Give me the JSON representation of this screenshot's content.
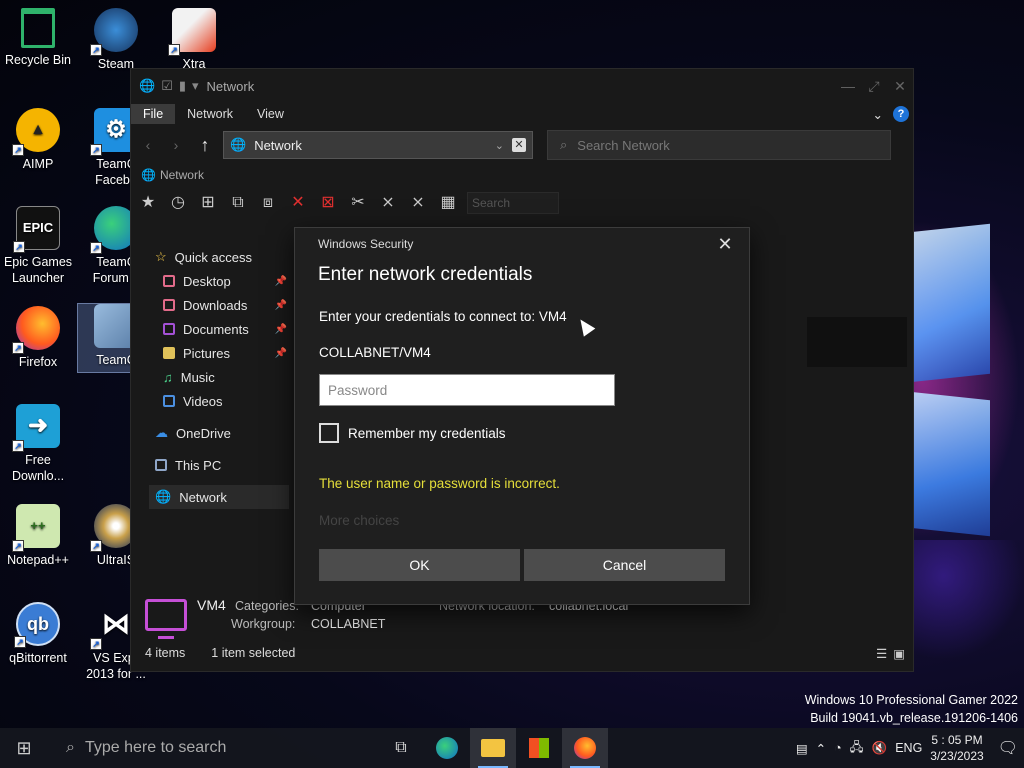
{
  "colors": {
    "accent": "#1e73d8",
    "error": "#e6df3a",
    "delete_red": "#e03030",
    "pc_icon": "#c54fd6"
  },
  "desktop": {
    "icons": [
      {
        "label": "Recycle Bin",
        "icon": "recycle-bin-icon"
      },
      {
        "label": "Steam",
        "icon": "steam-icon"
      },
      {
        "label": "Xtra",
        "icon": "xtra-icon"
      },
      {
        "label": "AIMP",
        "icon": "aimp-icon"
      },
      {
        "label": "TeamC Facebo",
        "icon": "teamcenter-icon"
      },
      {
        "label": "Epic Games Launcher",
        "icon": "epic-games-icon"
      },
      {
        "label": "TeamC Forum L",
        "icon": "edge-icon"
      },
      {
        "label": "Firefox",
        "icon": "firefox-icon"
      },
      {
        "label": "TeamC",
        "icon": "teamc-icon"
      },
      {
        "label": "Free Downlo...",
        "icon": "free-download-icon"
      },
      {
        "label": "Notepad++",
        "icon": "notepad-plus-plus-icon"
      },
      {
        "label": "UltraIS",
        "icon": "ultraiso-icon"
      },
      {
        "label": "qBittorrent",
        "icon": "qbittorrent-icon"
      },
      {
        "label": "VS Expr 2013 for ...",
        "icon": "vs-express-icon"
      }
    ],
    "watermark_line1": "Windows 10 Professional Gamer 2022",
    "watermark_line2": "Build 19041.vb_release.191206-1406"
  },
  "explorer": {
    "title": "Network",
    "tabs": [
      "File",
      "Network",
      "View"
    ],
    "address": "Network",
    "search_placeholder": "Search Network",
    "crumb": "Network",
    "toolbar_search_placeholder": "Search",
    "nav": {
      "quick_access": "Quick access",
      "desktop": "Desktop",
      "downloads": "Downloads",
      "documents": "Documents",
      "pictures": "Pictures",
      "music": "Music",
      "videos": "Videos",
      "onedrive": "OneDrive",
      "this_pc": "This PC",
      "network": "Network"
    },
    "details": {
      "name": "VM4",
      "categories_label": "Categories:",
      "categories_value": "Computer",
      "workgroup_label": "Workgroup:",
      "workgroup_value": "COLLABNET",
      "location_label": "Network location:",
      "location_value": "collabnet.local"
    },
    "status": {
      "items": "4 items",
      "selected": "1 item selected"
    }
  },
  "dialog": {
    "source": "Windows Security",
    "title": "Enter network credentials",
    "prompt": "Enter your credentials to connect to: VM4",
    "username": "COLLABNET/VM4",
    "password_placeholder": "Password",
    "remember": "Remember my credentials",
    "error": "The user name or password is incorrect.",
    "more_choices": "More choices",
    "ok": "OK",
    "cancel": "Cancel"
  },
  "taskbar": {
    "search_placeholder": "Type here to search",
    "language": "ENG",
    "time": "5 : 05 PM",
    "date": "3/23/2023"
  }
}
